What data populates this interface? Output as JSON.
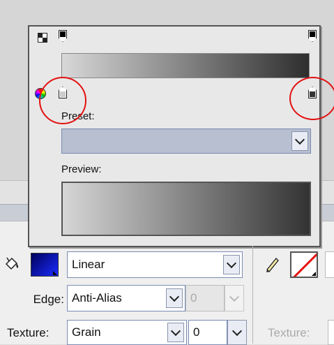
{
  "gradient_editor": {
    "preset_label": "Preset:",
    "preset_value": "",
    "preview_label": "Preview:",
    "stops": {
      "top_left_color": "#000000",
      "top_right_color": "#000000",
      "bottom_left_color": "#cccccc",
      "bottom_right_color": "#333333"
    },
    "gradient_start": "#d8d8d8",
    "gradient_end": "#2e2e2e"
  },
  "toolbar": {
    "fill_color": "#0a16a8",
    "fill_type": "Linear",
    "edge_label": "Edge:",
    "edge_value": "Anti-Alias",
    "edge_amount": "0",
    "texture_label": "Texture:",
    "texture_value": "Grain",
    "texture_amount": "0",
    "stroke_texture_label": "Texture:"
  }
}
